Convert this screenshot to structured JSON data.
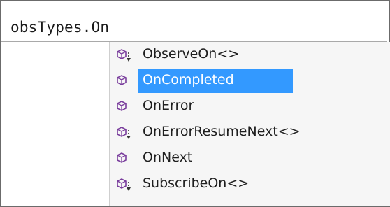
{
  "editor": {
    "code_text": "obsTypes.On"
  },
  "completion": {
    "items": [
      {
        "label": "ObserveOn<>",
        "icon": "extension-method-icon",
        "selected": false
      },
      {
        "label": "OnCompleted",
        "icon": "method-icon",
        "selected": true
      },
      {
        "label": "OnError",
        "icon": "method-icon",
        "selected": false
      },
      {
        "label": "OnErrorResumeNext<>",
        "icon": "extension-method-icon",
        "selected": false
      },
      {
        "label": "OnNext",
        "icon": "method-icon",
        "selected": false
      },
      {
        "label": "SubscribeOn<>",
        "icon": "extension-method-icon",
        "selected": false
      }
    ],
    "colors": {
      "selection": "#3399ff",
      "icon": "#7a3e9d"
    }
  }
}
